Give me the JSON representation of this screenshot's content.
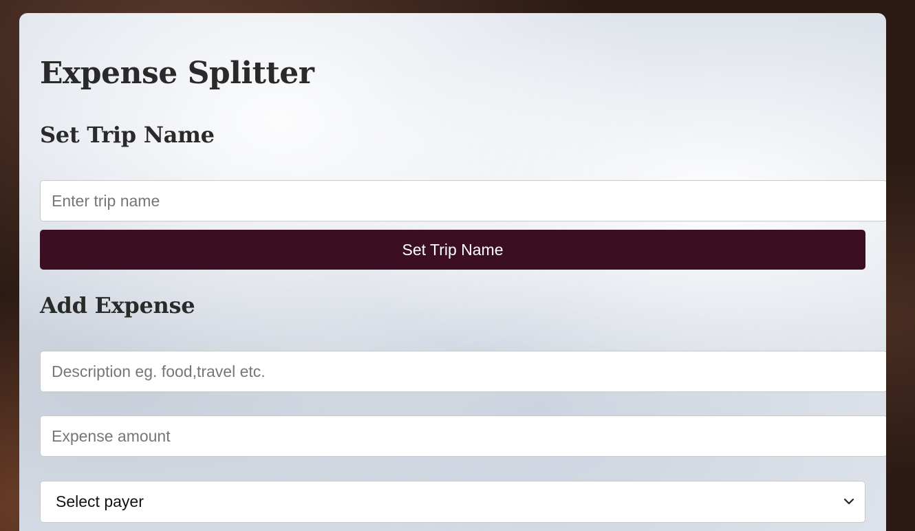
{
  "app": {
    "title": "Expense Splitter"
  },
  "trip": {
    "heading": "Set Trip Name",
    "name_placeholder": "Enter trip name",
    "button_label": "Set Trip Name"
  },
  "expense": {
    "heading": "Add Expense",
    "description_placeholder": "Description eg. food,travel etc.",
    "amount_placeholder": "Expense amount",
    "payer_select_value": "Select payer"
  },
  "icons": {
    "payer_dropdown": "chevron-down-icon"
  },
  "colors": {
    "primary_button": "#3b0e22",
    "heading_text": "#2a2a2a"
  }
}
